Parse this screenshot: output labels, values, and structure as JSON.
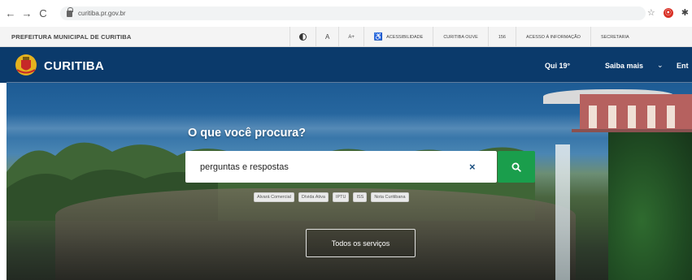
{
  "browser": {
    "url": "curitiba.pr.gov.br",
    "back_glyph": "←",
    "forward_glyph": "→",
    "reload_glyph": "C",
    "star_glyph": "☆",
    "ext_glyph": "⦿",
    "puzzle_glyph": "✱"
  },
  "gov_bar": {
    "title": "PREFEITURA MUNICIPAL DE CURITIBA",
    "font_small": "A",
    "font_large": "A+",
    "access_glyph": "♿",
    "items": [
      "ACESSIBILIDADE",
      "CURITIBA OUVE",
      "156",
      "ACESSO À INFORMAÇÃO",
      "SECRETARIA"
    ]
  },
  "header": {
    "brand": "CURITIBA",
    "weather": "Qui 19°",
    "saiba": "Saiba mais",
    "chevron": "⌄",
    "entrar": "Ent"
  },
  "search": {
    "title": "O que você procura?",
    "value": "perguntas e respostas",
    "clear_glyph": "×",
    "tags": [
      "Alvará Comercial",
      "Dívida Ativa",
      "IPTU",
      "ISS",
      "Nota Curitibana"
    ],
    "all_services": "Todos os serviços"
  },
  "colors": {
    "header_blue": "#0b3a6b",
    "search_green": "#1a9e4c"
  }
}
